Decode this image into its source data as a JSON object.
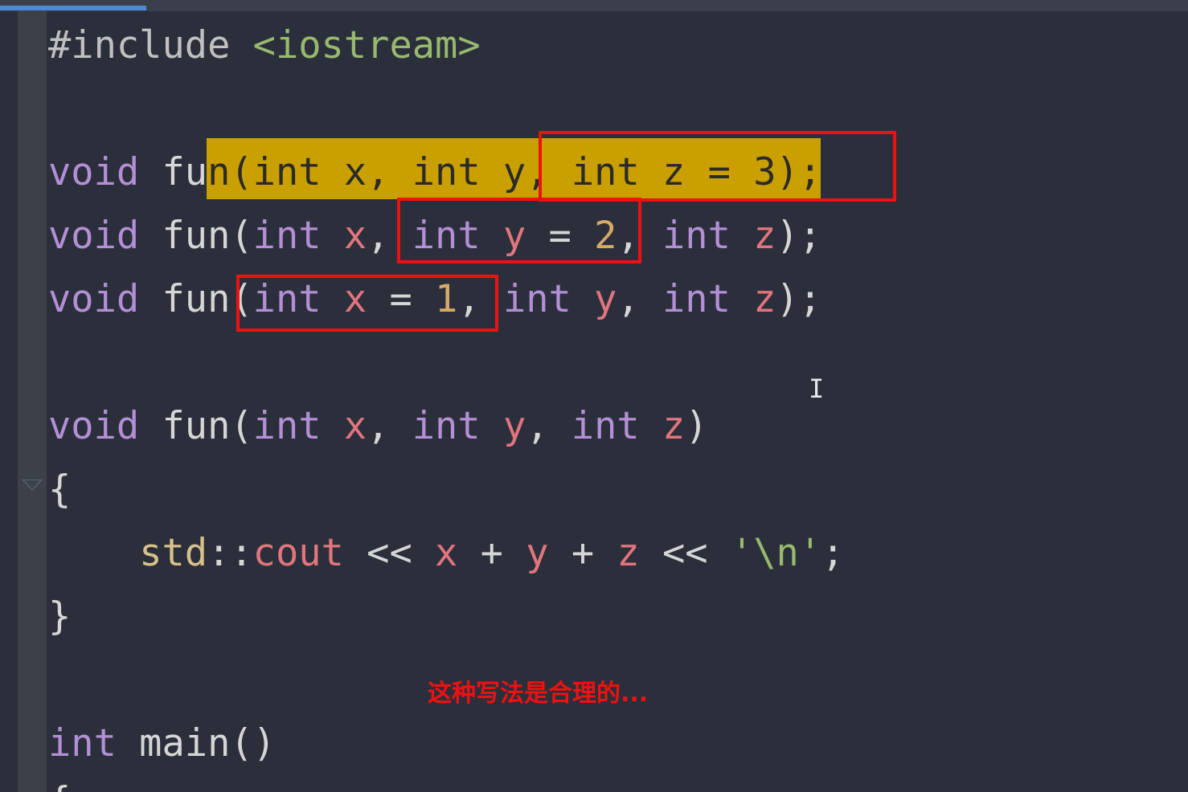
{
  "editor": {
    "lines": {
      "l1": {
        "directive": "#include ",
        "header": "<iostream>"
      },
      "l3": {
        "t1": "void",
        "t2": " fu",
        "t3": "n(int x, int y, int z = 3);"
      },
      "l4": {
        "t1": "void",
        "t2": " fun(",
        "t3": "int",
        "t4": " ",
        "t5": "x",
        "t6": ", ",
        "t7": "int",
        "t8": " ",
        "t9": "y",
        "t10": " = ",
        "t11": "2",
        "t12": ", ",
        "t13": "int",
        "t14": " ",
        "t15": "z",
        "t16": ");"
      },
      "l5": {
        "t1": "void",
        "t2": " fun(",
        "t3": "int",
        "t4": " ",
        "t5": "x",
        "t6": " = ",
        "t7": "1",
        "t8": ", ",
        "t9": "int",
        "t10": " ",
        "t11": "y",
        "t12": ", ",
        "t13": "int",
        "t14": " ",
        "t15": "z",
        "t16": ");"
      },
      "l7": {
        "t1": "void",
        "t2": " fun(",
        "t3": "int",
        "t4": " ",
        "t5": "x",
        "t6": ", ",
        "t7": "int",
        "t8": " ",
        "t9": "y",
        "t10": ", ",
        "t11": "int",
        "t12": " ",
        "t13": "z",
        "t14": ")"
      },
      "l8": {
        "t1": "{"
      },
      "l9": {
        "t0": "    ",
        "t1": "std",
        "t2": "::",
        "t3": "cout",
        "t4": " << ",
        "t5": "x",
        "t6": " + ",
        "t7": "y",
        "t8": " + ",
        "t9": "z",
        "t10": " << ",
        "t11": "'\\n'",
        "t12": ";"
      },
      "l10": {
        "t1": "}"
      },
      "l12": {
        "t1": "int",
        "t2": " main()"
      },
      "l13": {
        "t1": "{"
      }
    },
    "annotation": "这种写法是合理的...",
    "cursor_glyph": "I"
  },
  "colors": {
    "background": "#2b2f3b",
    "gutter": "#3b4049",
    "keyword": "#b48fd6",
    "parameter": "#e1757d",
    "number": "#d7a86a",
    "string": "#98b96e",
    "selection_highlight": "#c9a000",
    "annotation_box": "#ee1111"
  },
  "icons": {
    "fold": "fold-arrow-icon",
    "cursor": "text-cursor-icon"
  }
}
